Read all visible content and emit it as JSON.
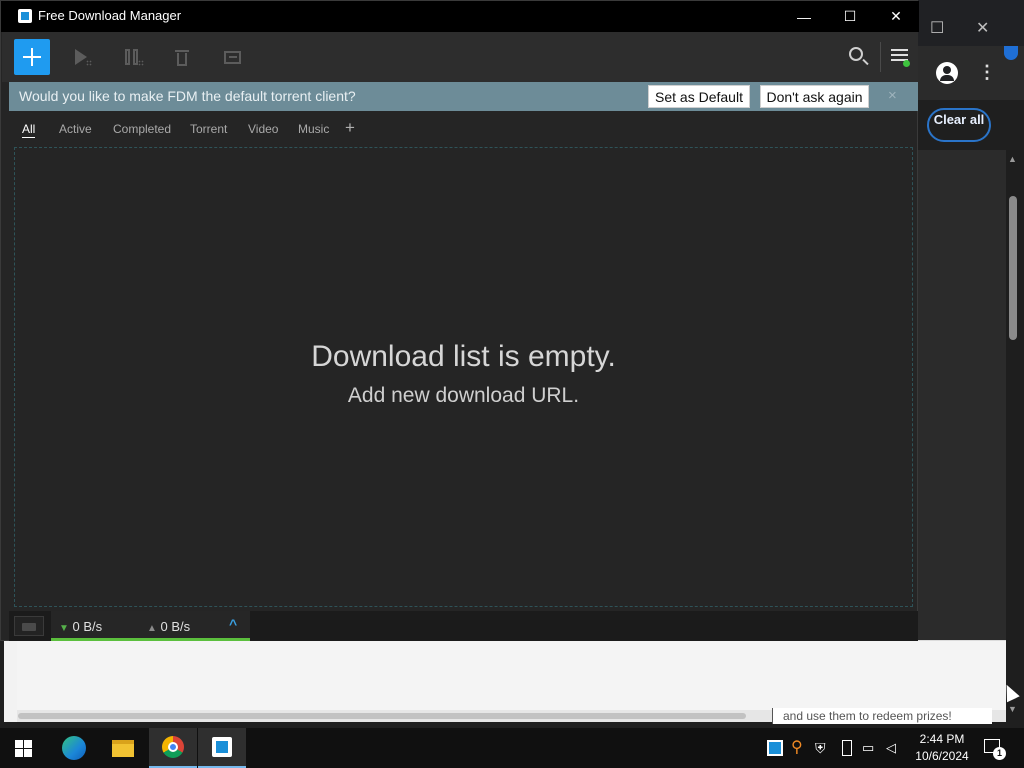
{
  "window": {
    "title": "Free Download Manager"
  },
  "titlebar_buttons": {
    "minimize": "—",
    "maximize": "☐",
    "close": "✕"
  },
  "banner": {
    "question": "Would you like to make FDM the default torrent client?",
    "set_default": "Set as Default",
    "dont_ask": "Don't ask again",
    "close": "×"
  },
  "tabs": [
    "All",
    "Active",
    "Completed",
    "Torrent",
    "Video",
    "Music"
  ],
  "tab_add": "+",
  "empty_state": {
    "line1": "Download list is empty.",
    "line2": "Add new download URL."
  },
  "status": {
    "download_speed": "0 B/s",
    "upload_speed": "0 B/s",
    "down_arrow": "▼",
    "up_arrow": "▲",
    "expand": "^"
  },
  "background_browser": {
    "clear_all": "Clear all",
    "prize_text": "and use them to redeem prizes!",
    "maximize": "☐",
    "close": "✕",
    "menu": "⋮"
  },
  "taskbar": {
    "time": "2:44 PM",
    "date": "10/6/2024",
    "notification_count": "1"
  },
  "colors": {
    "accent": "#1f9bf0",
    "banner": "#6d8c98",
    "speed_bar": "#5bbf3d",
    "status_dot": "#3ec33e"
  }
}
